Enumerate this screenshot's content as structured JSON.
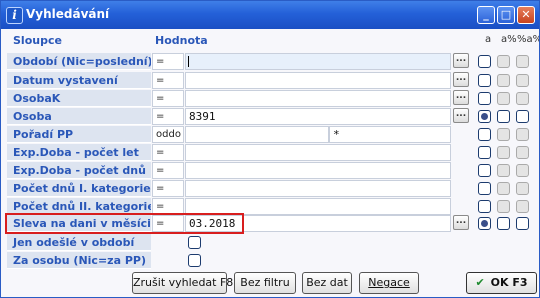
{
  "window": {
    "title": "Vyhledávání",
    "icon_glyph": "i",
    "minimize_glyph": "_",
    "maximize_glyph": "□",
    "close_glyph": "✕"
  },
  "header": {
    "col_label": "Sloupce",
    "col_value": "Hodnota",
    "flag_a": "a",
    "flag_a_percent": "a%",
    "flag_percent_a": "%a%"
  },
  "rows": [
    {
      "label": "Období (Nic=poslední)",
      "operator": "=",
      "value": "",
      "has_lookup": true
    },
    {
      "label": "Datum vystavení",
      "operator": "=",
      "value": "",
      "has_lookup": true
    },
    {
      "label": "OsobaK",
      "operator": "=",
      "value": "",
      "has_lookup": true
    },
    {
      "label": "Osoba",
      "operator": "=",
      "value": "8391",
      "has_lookup": true
    },
    {
      "label": "Pořadí PP",
      "operator": "oddo",
      "value": "",
      "value2": "*",
      "has_lookup": false
    },
    {
      "label": "Exp.Doba - počet let",
      "operator": "=",
      "value": "",
      "has_lookup": false
    },
    {
      "label": "Exp.Doba - počet dnů",
      "operator": "=",
      "value": "",
      "has_lookup": false
    },
    {
      "label": "Počet dnů I. kategorie",
      "operator": "=",
      "value": "",
      "has_lookup": false
    },
    {
      "label": "Počet dnů II. kategorie",
      "operator": "=",
      "value": "",
      "has_lookup": false
    },
    {
      "label": "Sleva na dani v měsíci",
      "operator": "=",
      "value": "03.2018",
      "has_lookup": true
    },
    {
      "label": "Jen odešlé v období",
      "operator": "",
      "value": "",
      "checkbox": true
    },
    {
      "label": "Za osobu (Nic=za PP)",
      "operator": "",
      "value": "",
      "checkbox": true
    }
  ],
  "lookup_glyph": "...",
  "buttons": {
    "clear": "Zrušit vyhledat F8",
    "no_filter": "Bez filtru",
    "no_data": "Bez dat",
    "negate": "Negace",
    "ok": "OK F3",
    "ok_icon": "✔"
  },
  "colors": {
    "title_bar": "#2460d8",
    "label_text": "#2a57b8",
    "highlight_border": "#d81e1e",
    "ok_check": "#1e8a2e"
  }
}
